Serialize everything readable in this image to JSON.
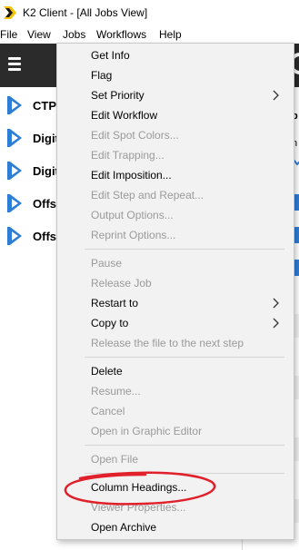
{
  "window": {
    "title": "K2 Client - [All Jobs View]",
    "logo_colors": {
      "yellow": "#f5c400",
      "dark": "#1a1a1a"
    }
  },
  "menubar": {
    "items": [
      "File",
      "View",
      "Jobs",
      "Workflows",
      "Help"
    ]
  },
  "toolbar": {
    "menu_icon": "hamburger-icon",
    "background": "#2b2b2b"
  },
  "jobs": {
    "rows": [
      {
        "label": "CTP"
      },
      {
        "label": "Digit"
      },
      {
        "label": "Digit"
      },
      {
        "label": "Offs"
      },
      {
        "label": "Offs"
      }
    ],
    "icon_color": "#2e7dd7"
  },
  "right_panel": {
    "header_fragment": "b",
    "sort_fragment": "n"
  },
  "jobs_menu": {
    "items": [
      {
        "label": "Get Info",
        "enabled": true
      },
      {
        "label": "Flag",
        "enabled": true
      },
      {
        "label": "Set Priority",
        "enabled": true,
        "submenu": true
      },
      {
        "label": "Edit Workflow",
        "enabled": true
      },
      {
        "label": "Edit Spot Colors...",
        "enabled": false
      },
      {
        "label": "Edit Trapping...",
        "enabled": false
      },
      {
        "label": "Edit Imposition...",
        "enabled": true
      },
      {
        "label": "Edit Step and Repeat...",
        "enabled": false
      },
      {
        "label": "Output Options...",
        "enabled": false
      },
      {
        "label": "Reprint Options...",
        "enabled": false
      },
      {
        "label": "Pause",
        "enabled": false
      },
      {
        "label": "Release Job",
        "enabled": false
      },
      {
        "label": "Restart to",
        "enabled": true,
        "submenu": true
      },
      {
        "label": "Copy to",
        "enabled": true,
        "submenu": true
      },
      {
        "label": "Release the file to the next step",
        "enabled": false
      },
      {
        "label": "Delete",
        "enabled": true
      },
      {
        "label": "Resume...",
        "enabled": false
      },
      {
        "label": "Cancel",
        "enabled": false
      },
      {
        "label": "Open in Graphic Editor",
        "enabled": false
      },
      {
        "label": "Open File",
        "enabled": false
      },
      {
        "label": "Column Headings...",
        "enabled": true,
        "highlighted": true
      },
      {
        "label": "Viewer Properties...",
        "enabled": false
      },
      {
        "label": "Open Archive",
        "enabled": true
      }
    ],
    "annotation_color": "#e0202a"
  }
}
